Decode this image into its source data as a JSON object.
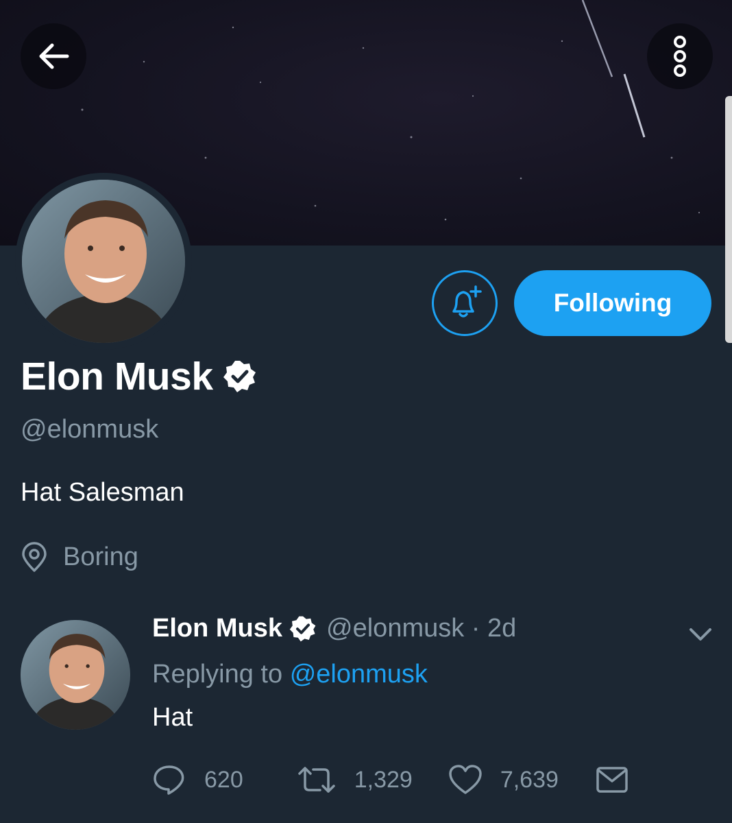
{
  "header": {
    "back_icon": "arrow-left-icon",
    "more_icon": "more-vertical-icon"
  },
  "profile": {
    "name": "Elon Musk",
    "handle": "@elonmusk",
    "bio": "Hat Salesman",
    "location": "Boring",
    "verified": true,
    "following_label": "Following",
    "notify_icon": "bell-plus-icon"
  },
  "tweet": {
    "author_name": "Elon Musk",
    "meta": "@elonmusk · 2d",
    "replying_prefix": "Replying to",
    "replying_to": "@elonmusk",
    "text": "Hat",
    "counts": {
      "replies": "620",
      "retweets": "1,329",
      "likes": "7,639"
    }
  },
  "colors": {
    "background": "#1c2733",
    "accent": "#1da1f2",
    "muted": "#8899a6",
    "text": "#ffffff"
  }
}
